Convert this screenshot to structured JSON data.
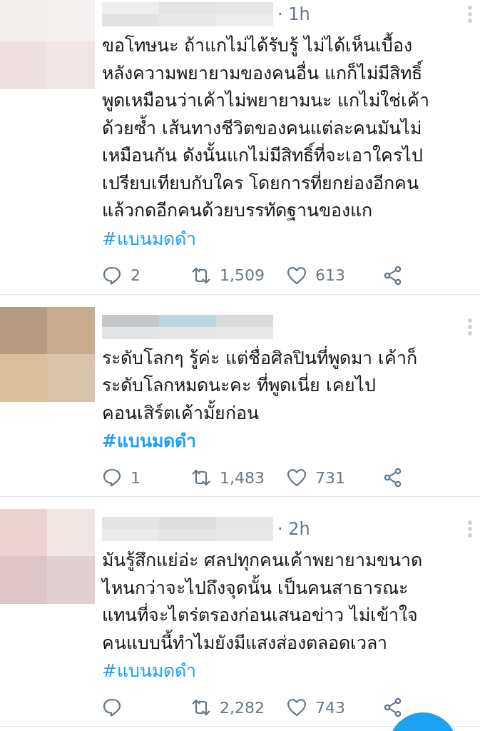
{
  "tweets": [
    {
      "time": "· 1h",
      "text": "ขอโทษนะ ถ้าแกไม่ได้รับรู้ ไม่ได้เห็นเบื้อง\nหลังความพยายามของคนอื่น แกก็ไม่มีสิทธิ์\nพูดเหมือนว่าเค้าไม่พยายามนะ แกไม่ใช่เค้า\nด้วยซ้ำ เส้นทางชีวิตของคนแต่ละคนมันไม่\nเหมือนกัน ดังนั้นแกไม่มีสิทธิ์ที่จะเอาใครไป\nเปรียบเทียบกับใคร โดยการที่ยกย่องอีกคน\nแล้วกดอีกคนด้วยบรรทัดฐานของแก",
      "hashtag": "#แบนมดดำ",
      "hashtag_bold": false,
      "replies": "2",
      "retweets": "1,509",
      "likes": "613"
    },
    {
      "text": "ระดับโลกๆ รู้ค่ะ แต่ชื่อศิลปินที่พูดมา เค้าก็\nระดับโลกหมดนะคะ ที่พูดเนี่ย เคยไป\nคอนเสิร์ตเค้ามั้ยก่อน",
      "hashtag": "#แบนมดดำ",
      "hashtag_bold": true,
      "replies": "1",
      "retweets": "1,483",
      "likes": "731"
    },
    {
      "time": "· 2h",
      "text": "มันรู้สึกแย่อ่ะ ศลปทุกคนเค้าพยายามขนาด\nไหนกว่าจะไปถึงจุดนั้น เป็นคนสาธารณะ\nแทนที่จะไตร่ตรองก่อนเสนอข่าว ไม่เข้าใจ\nคนแบบนี้ทำไมยังมีแสงส่องตลอดเวลา",
      "hashtag": "#แบนมดดำ",
      "hashtag_bold": false,
      "retweets": "2,282",
      "likes": "743"
    }
  ]
}
